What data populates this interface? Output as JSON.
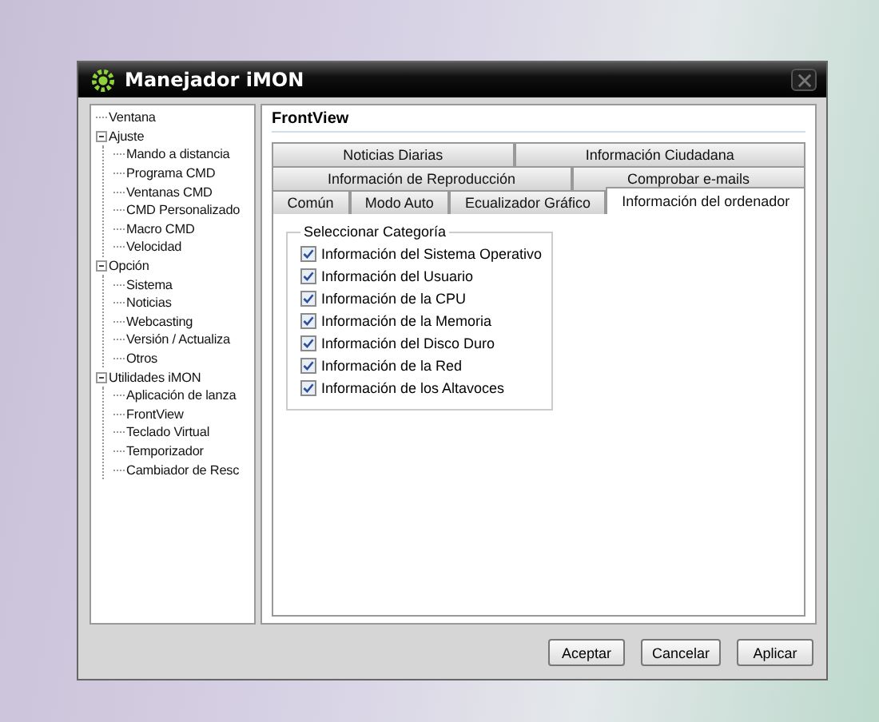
{
  "window": {
    "title": "Manejador iMON"
  },
  "tree": [
    {
      "label": "Ventana"
    },
    {
      "label": "Ajuste",
      "expanded": true,
      "children": [
        {
          "label": "Mando a distancia"
        },
        {
          "label": "Programa CMD"
        },
        {
          "label": "Ventanas CMD"
        },
        {
          "label": "CMD Personalizado"
        },
        {
          "label": "Macro  CMD"
        },
        {
          "label": "Velocidad"
        }
      ]
    },
    {
      "label": "Opción",
      "expanded": true,
      "children": [
        {
          "label": "Sistema"
        },
        {
          "label": "Noticias"
        },
        {
          "label": "Webcasting"
        },
        {
          "label": "Versión / Actualiza"
        },
        {
          "label": "Otros"
        }
      ]
    },
    {
      "label": "Utilidades iMON",
      "expanded": true,
      "children": [
        {
          "label": "Aplicación de lanza"
        },
        {
          "label": "FrontView"
        },
        {
          "label": "Teclado Virtual"
        },
        {
          "label": "Temporizador"
        },
        {
          "label": "Cambiador de Resc"
        }
      ]
    }
  ],
  "panel": {
    "title": "FrontView"
  },
  "tab_rows": [
    [
      {
        "label": "Noticias Diarias",
        "selected": false
      },
      {
        "label": "Información Ciudadana",
        "selected": false
      }
    ],
    [
      {
        "label": "Información de Reproducción",
        "selected": false
      },
      {
        "label": "Comprobar e-mails",
        "selected": false
      }
    ],
    [
      {
        "label": "Común",
        "selected": false
      },
      {
        "label": "Modo Auto",
        "selected": false
      },
      {
        "label": "Ecualizador Gráfico",
        "selected": false
      },
      {
        "label": "Información del ordenador",
        "selected": true
      }
    ]
  ],
  "group": {
    "title": "Seleccionar Categoría",
    "options": [
      {
        "label": "Información del Sistema Operativo",
        "checked": true
      },
      {
        "label": "Información del Usuario",
        "checked": true
      },
      {
        "label": "Información de la CPU",
        "checked": true
      },
      {
        "label": "Información de la Memoria",
        "checked": true
      },
      {
        "label": "Información del Disco Duro",
        "checked": true
      },
      {
        "label": "Información de la Red",
        "checked": true
      },
      {
        "label": "Información de los Altavoces",
        "checked": true
      }
    ]
  },
  "buttons": [
    "Aceptar",
    "Cancelar",
    "Aplicar"
  ]
}
